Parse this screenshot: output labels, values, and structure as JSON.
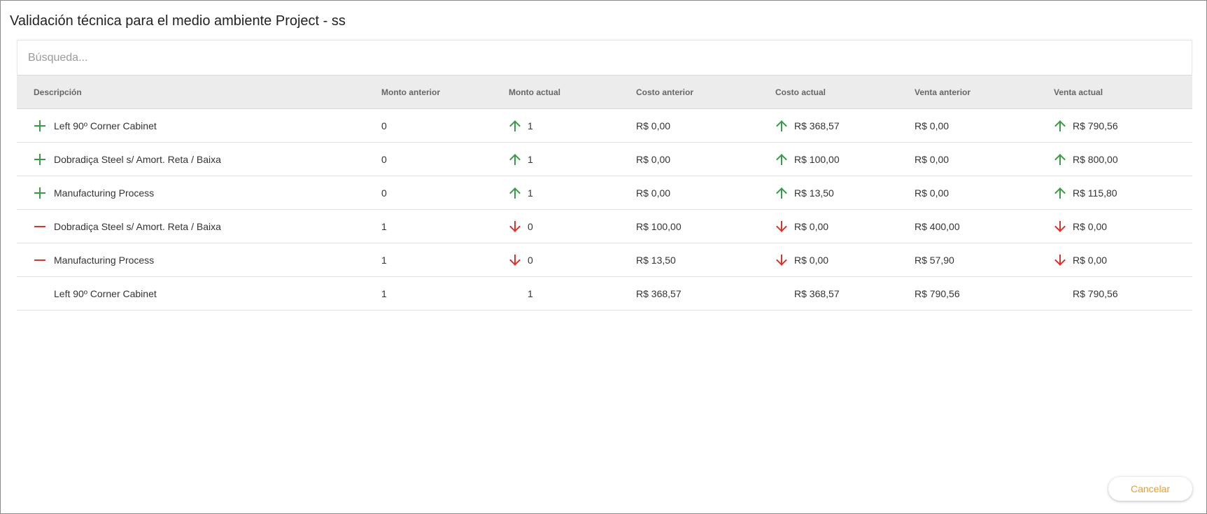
{
  "dialog": {
    "title": "Validación técnica para el medio ambiente Project - ss",
    "cancel_label": "Cancelar"
  },
  "search": {
    "placeholder": "Búsqueda..."
  },
  "table": {
    "headers": {
      "description": "Descripción",
      "prev_amount": "Monto anterior",
      "curr_amount": "Monto actual",
      "prev_cost": "Costo anterior",
      "curr_cost": "Costo actual",
      "prev_sale": "Venta anterior",
      "curr_sale": "Venta actual"
    },
    "rows": [
      {
        "change": "added",
        "description": "Left 90º Corner Cabinet",
        "prev_amount": "0",
        "curr_amount": "1",
        "amount_dir": "up",
        "prev_cost": "R$ 0,00",
        "curr_cost": "R$ 368,57",
        "cost_dir": "up",
        "prev_sale": "R$ 0,00",
        "curr_sale": "R$ 790,56",
        "sale_dir": "up"
      },
      {
        "change": "added",
        "description": "Dobradiça Steel s/ Amort. Reta / Baixa",
        "prev_amount": "0",
        "curr_amount": "1",
        "amount_dir": "up",
        "prev_cost": "R$ 0,00",
        "curr_cost": "R$ 100,00",
        "cost_dir": "up",
        "prev_sale": "R$ 0,00",
        "curr_sale": "R$ 800,00",
        "sale_dir": "up"
      },
      {
        "change": "added",
        "description": "Manufacturing Process",
        "prev_amount": "0",
        "curr_amount": "1",
        "amount_dir": "up",
        "prev_cost": "R$ 0,00",
        "curr_cost": "R$ 13,50",
        "cost_dir": "up",
        "prev_sale": "R$ 0,00",
        "curr_sale": "R$ 115,80",
        "sale_dir": "up"
      },
      {
        "change": "removed",
        "description": "Dobradiça Steel s/ Amort. Reta / Baixa",
        "prev_amount": "1",
        "curr_amount": "0",
        "amount_dir": "down",
        "prev_cost": "R$ 100,00",
        "curr_cost": "R$ 0,00",
        "cost_dir": "down",
        "prev_sale": "R$ 400,00",
        "curr_sale": "R$ 0,00",
        "sale_dir": "down"
      },
      {
        "change": "removed",
        "description": "Manufacturing Process",
        "prev_amount": "1",
        "curr_amount": "0",
        "amount_dir": "down",
        "prev_cost": "R$ 13,50",
        "curr_cost": "R$ 0,00",
        "cost_dir": "down",
        "prev_sale": "R$ 57,90",
        "curr_sale": "R$ 0,00",
        "sale_dir": "down"
      },
      {
        "change": "none",
        "description": "Left 90º Corner Cabinet",
        "prev_amount": "1",
        "curr_amount": "1",
        "amount_dir": "none",
        "prev_cost": "R$ 368,57",
        "curr_cost": "R$ 368,57",
        "cost_dir": "none",
        "prev_sale": "R$ 790,56",
        "curr_sale": "R$ 790,56",
        "sale_dir": "none"
      }
    ]
  },
  "colors": {
    "added": "#3a9a46",
    "removed": "#d9332b",
    "accent": "#f29a1e"
  },
  "icons": {
    "added": "plus-icon",
    "removed": "minus-icon",
    "up": "arrow-up-icon",
    "down": "arrow-down-icon"
  }
}
